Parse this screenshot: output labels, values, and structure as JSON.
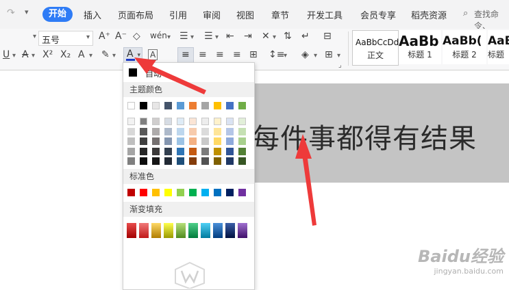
{
  "menubar": {
    "tabs": [
      "开始",
      "插入",
      "页面布局",
      "引用",
      "审阅",
      "视图",
      "章节",
      "开发工具",
      "会员专享",
      "稻壳资源"
    ],
    "active": "开始",
    "search": "查找命令、"
  },
  "ribbon": {
    "font_size": "五号",
    "style_sample_1": "AaBbCcDd",
    "style_sample_2": "AaBb",
    "style_sample_3": "AaBb(",
    "style_sample_4": "AaB",
    "style_label_1": "正文",
    "style_label_2": "标题 1",
    "style_label_3": "标题 2",
    "style_label_4": "标题"
  },
  "panel": {
    "auto_label": "自动",
    "theme_colors_title": "主题颜色",
    "standard_colors_title": "标准色",
    "gradient_title": "渐变填充",
    "theme_row": [
      "#ffffff",
      "#000000",
      "#e7e6e6",
      "#44546a",
      "#5b9bd5",
      "#ed7d31",
      "#a5a5a5",
      "#ffc000",
      "#4472c4",
      "#70ad47"
    ],
    "theme_shades": [
      [
        "#f2f2f2",
        "#7f7f7f",
        "#d0cece",
        "#d6dce4",
        "#deebf6",
        "#fbe5d5",
        "#ededed",
        "#fff2cc",
        "#dae3f3",
        "#e2efd9"
      ],
      [
        "#d8d8d8",
        "#595959",
        "#aeabab",
        "#adb9ca",
        "#bdd7ee",
        "#f7cbac",
        "#dbdbdb",
        "#fee599",
        "#b4c6e7",
        "#c5e0b3"
      ],
      [
        "#bfbfbf",
        "#3f3f3f",
        "#757070",
        "#8496b0",
        "#9cc3e5",
        "#f4b183",
        "#c9c9c9",
        "#ffd965",
        "#8eaadb",
        "#a8d08d"
      ],
      [
        "#a5a5a5",
        "#262626",
        "#3a3838",
        "#323f4f",
        "#2e75b5",
        "#c55a11",
        "#7b7b7b",
        "#bf9000",
        "#2f5496",
        "#538135"
      ],
      [
        "#7f7f7f",
        "#0c0c0c",
        "#171616",
        "#222a35",
        "#1e4e79",
        "#843c0b",
        "#525252",
        "#7f6000",
        "#1f3864",
        "#375623"
      ]
    ],
    "standard": [
      "#c00000",
      "#ff0000",
      "#ffc000",
      "#ffff00",
      "#92d050",
      "#00b050",
      "#00b0f0",
      "#0070c0",
      "#002060",
      "#7030a0"
    ],
    "gradient": [
      [
        "#e84c4c",
        "#a30000"
      ],
      [
        "#f07a7a",
        "#c01818"
      ],
      [
        "#ffd966",
        "#b07d00"
      ],
      [
        "#ffff4d",
        "#9a9a00"
      ],
      [
        "#b6e07a",
        "#4f8a1e"
      ],
      [
        "#4fd08a",
        "#007a3a"
      ],
      [
        "#4fd0f5",
        "#007a9e"
      ],
      [
        "#4a90d9",
        "#003c80"
      ],
      [
        "#3a5fa8",
        "#001040"
      ],
      [
        "#a070d0",
        "#40106a"
      ]
    ]
  },
  "document": {
    "text": "每件事都得有结果"
  },
  "watermark": {
    "brand": "Baidu经验",
    "url": "jingyan.baidu.com"
  }
}
